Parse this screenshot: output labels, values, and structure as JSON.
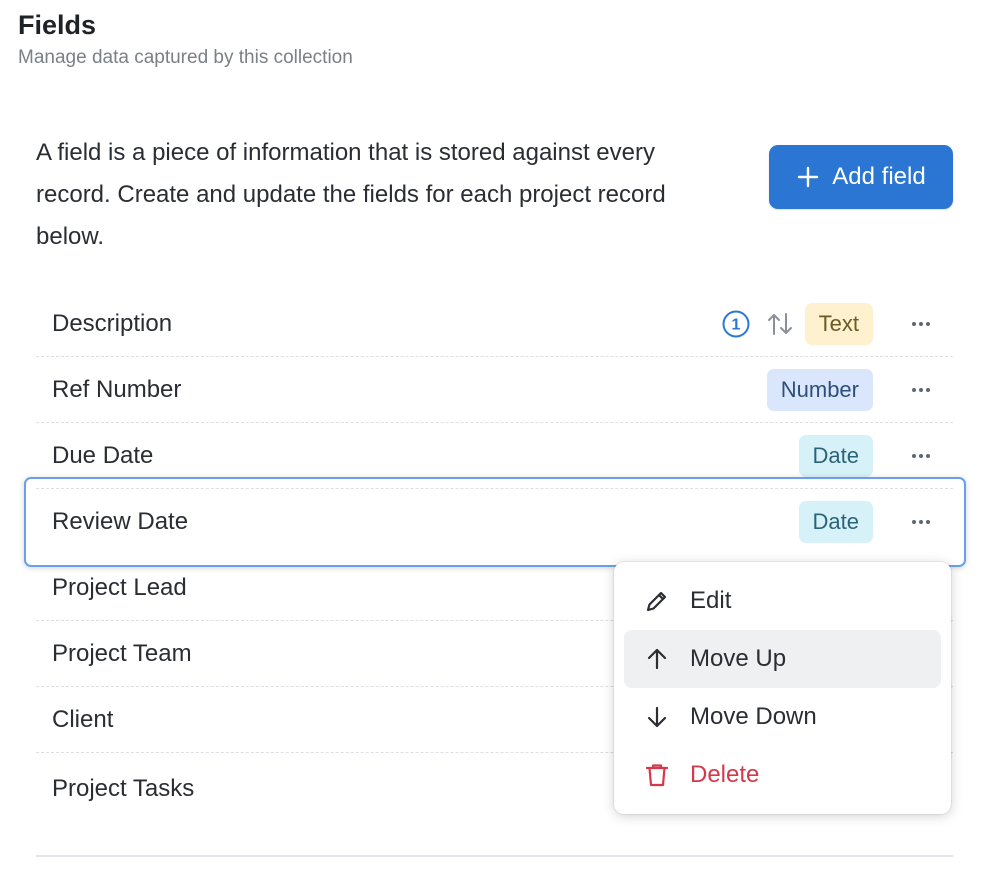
{
  "header": {
    "title": "Fields",
    "subtitle": "Manage data captured by this collection"
  },
  "intro": "A field is a piece of information that is stored against every record. Create and update the fields for each project record below.",
  "add_button": {
    "label": "Add field",
    "icon": "plus-icon"
  },
  "fields": [
    {
      "name": "Description",
      "type": "Text",
      "indicator": "1",
      "sort_icon": "sort-arrows-icon"
    },
    {
      "name": "Ref Number",
      "type": "Number"
    },
    {
      "name": "Due Date",
      "type": "Date"
    },
    {
      "name": "Review Date",
      "type": "Date",
      "selected": true
    },
    {
      "name": "Project Lead"
    },
    {
      "name": "Project Team"
    },
    {
      "name": "Client"
    },
    {
      "name": "Project Tasks"
    }
  ],
  "context_menu": {
    "items": [
      {
        "label": "Edit",
        "icon": "pencil-icon"
      },
      {
        "label": "Move Up",
        "icon": "arrow-up-icon",
        "highlighted": true
      },
      {
        "label": "Move Down",
        "icon": "arrow-down-icon"
      },
      {
        "label": "Delete",
        "icon": "trash-icon",
        "danger": true
      }
    ]
  },
  "colors": {
    "accent": "#2b76d2",
    "text_badge_bg": "#fdf1cf",
    "number_badge_bg": "#d9e6fb",
    "date_badge_bg": "#d6f1f8",
    "danger": "#d4384a",
    "selection_border": "#6aa0ea"
  }
}
